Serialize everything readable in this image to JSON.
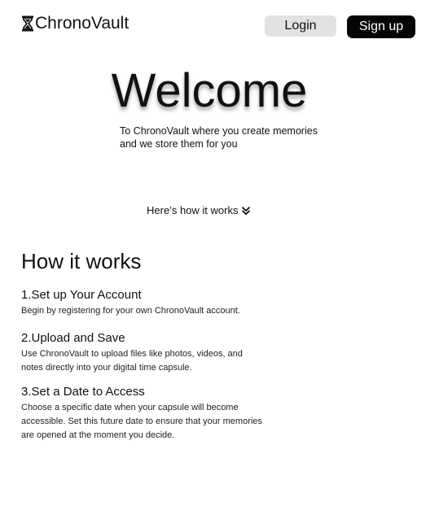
{
  "header": {
    "logo_icon": "hourglass-icon",
    "logo_text": "ChronoVault",
    "login_label": "Login",
    "signup_label": "Sign up"
  },
  "hero": {
    "title": "Welcome",
    "subtitle": "To ChronoVault where you create memories and we store them for you",
    "how_link_label": "Here’s how it works",
    "how_link_icon": "double-chevron-down-icon"
  },
  "how_it_works": {
    "title": "How it works",
    "steps": [
      {
        "title": "1.Set up Your Account",
        "description": "Begin by registering for your own ChronoVault account."
      },
      {
        "title": "2.Upload and Save",
        "description": "Use ChronoVault to upload files like photos, videos, and notes directly into your digital time capsule."
      },
      {
        "title": "3.Set a Date to Access",
        "description": "Choose a specific date when your capsule will become accessible. Set this future date to ensure that your memories are opened at the moment you decide."
      }
    ]
  },
  "colors": {
    "primary_button_bg": "#050505",
    "secondary_button_bg": "#e2e2e2",
    "text": "#111111",
    "background": "#ffffff"
  }
}
